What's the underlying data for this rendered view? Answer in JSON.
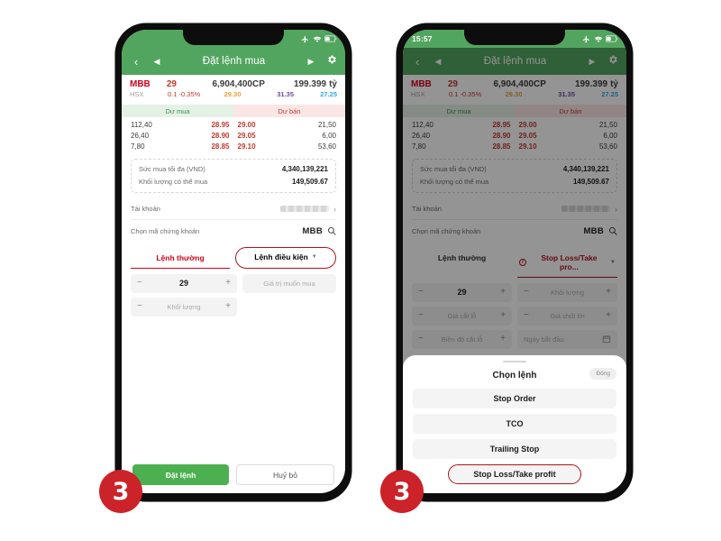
{
  "meta": {
    "step_badge": "3"
  },
  "statusbar": {
    "time_phone1": "",
    "time_phone2": "15:57",
    "icons": [
      "airplane-icon",
      "wifi-icon",
      "battery-icon"
    ]
  },
  "navbar": {
    "back_icon": "chevron-left-icon",
    "prev_icon": "triangle-left-icon",
    "title": "Đặt lệnh mua",
    "next_icon": "triangle-right-icon",
    "settings_icon": "gear-icon"
  },
  "quote": {
    "symbol": "MBB",
    "exchange": "HSX",
    "price": "29",
    "change": "0.1",
    "change_pct": "-0.35%",
    "volume": "6,904,400",
    "volume_unit": "CP",
    "ref_price": "29.30",
    "value": "199.399",
    "value_unit": "tỷ",
    "ceiling": "31.35",
    "floor": "27.25"
  },
  "depth": {
    "header_buy": "Dư mua",
    "header_sell": "Dư bán",
    "rows": [
      {
        "buy_vol": "112,40",
        "buy_price": "28.95",
        "sell_price": "29.00",
        "sell_vol": "21,50"
      },
      {
        "buy_vol": "26,40",
        "buy_price": "28.90",
        "sell_price": "29.05",
        "sell_vol": "6,00"
      },
      {
        "buy_vol": "7,80",
        "buy_price": "28.85",
        "sell_price": "29.10",
        "sell_vol": "53,60"
      }
    ]
  },
  "info": {
    "buying_power_label": "Sức mua tối đa (VND)",
    "buying_power_value": "4,340,139,221",
    "max_qty_label": "Khối lượng có thể mua",
    "max_qty_value": "149,509.67"
  },
  "fields": {
    "account_label": "Tài khoản",
    "account_value_redacted": "account-redacted",
    "account_chevron": "chevron-right-icon",
    "symbol_label": "Chọn mã chứng khoán",
    "symbol_value": "MBB",
    "search_icon": "search-icon"
  },
  "tabs": {
    "normal": "Lệnh thường",
    "conditional_phone1": "Lệnh điều kiện",
    "conditional_phone2": "Stop Loss/Take pro...",
    "caret_icon": "chevron-down-icon",
    "info_icon": "info-circle-icon"
  },
  "inputs_phone1": {
    "price_minus": "−",
    "price_value": "29",
    "price_plus": "+",
    "order_value_placeholder": "Giá trị muốn mua",
    "qty_minus": "−",
    "qty_placeholder": "Khối lượng",
    "qty_plus": "+"
  },
  "inputs_phone2": {
    "rows": [
      {
        "left_value": "29",
        "left_placeholder": "",
        "right_placeholder": "Khối lượng",
        "right_is_date": false
      },
      {
        "left_value": "",
        "left_placeholder": "Giá cắt lỗ",
        "right_placeholder": "Giá chốt lời",
        "right_is_date": false
      },
      {
        "left_value": "",
        "left_placeholder": "Biên độ cắt lỗ",
        "right_placeholder": "Ngày bắt đầu",
        "right_is_date": true
      }
    ],
    "minus": "−",
    "plus": "+",
    "calendar_icon": "calendar-icon"
  },
  "actions": {
    "submit": "Đặt lệnh",
    "cancel": "Huỷ bỏ"
  },
  "sheet": {
    "title": "Chọn lệnh",
    "close_label": "Đóng",
    "options": [
      {
        "label": "Stop Order",
        "selected": false
      },
      {
        "label": "TCO",
        "selected": false
      },
      {
        "label": "Trailing Stop",
        "selected": false
      },
      {
        "label": "Stop Loss/Take profit",
        "selected": true
      }
    ]
  },
  "colors": {
    "brand_green": "#52a55f",
    "submit_green": "#4caf50",
    "accent_red": "#d0021b",
    "highlight_red": "#b3121c",
    "badge_red": "#cc2229",
    "ceiling_purple": "#6d4ea8",
    "floor_blue": "#33a9e0",
    "ref_yellow": "#e8a33d"
  }
}
